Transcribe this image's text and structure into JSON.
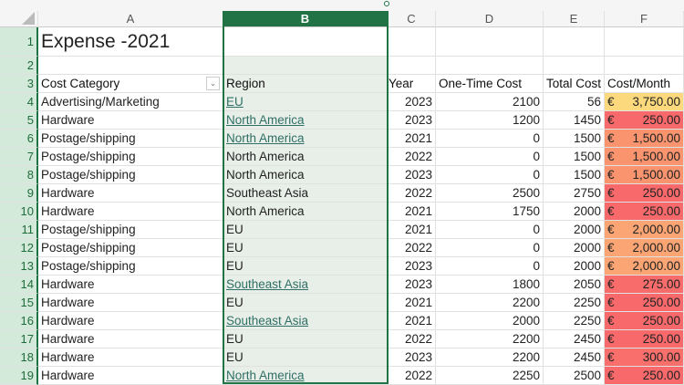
{
  "columns": [
    "A",
    "B",
    "C",
    "D",
    "E",
    "F"
  ],
  "title": "Expense -2021",
  "headers": {
    "a": "Cost Category",
    "b": "Region",
    "c": "Year",
    "d": "One-Time Cost",
    "e": "Total Cost",
    "f": "Cost/Month"
  },
  "currency_symbol": "€",
  "rows": [
    {
      "n": "4",
      "a": "Advertising/Marketing",
      "b": "EU",
      "link": true,
      "c": "2023",
      "d": "2100",
      "e": "56",
      "f": "3,750.00",
      "color": "#fbd97c"
    },
    {
      "n": "5",
      "a": "Hardware",
      "b": "North America",
      "link": true,
      "c": "2023",
      "d": "1200",
      "e": "1450",
      "f": "250.00",
      "color": "#f8696b"
    },
    {
      "n": "6",
      "a": "Postage/shipping",
      "b": "North America",
      "link": true,
      "c": "2021",
      "d": "0",
      "e": "1500",
      "f": "1,500.00",
      "color": "#f9946f"
    },
    {
      "n": "7",
      "a": "Postage/shipping",
      "b": "North America",
      "link": false,
      "c": "2022",
      "d": "0",
      "e": "1500",
      "f": "1,500.00",
      "color": "#f9946f"
    },
    {
      "n": "8",
      "a": "Postage/shipping",
      "b": "North America",
      "link": false,
      "c": "2023",
      "d": "0",
      "e": "1500",
      "f": "1,500.00",
      "color": "#f9946f"
    },
    {
      "n": "9",
      "a": "Hardware",
      "b": "Southeast Asia",
      "link": false,
      "c": "2022",
      "d": "2500",
      "e": "2750",
      "f": "250.00",
      "color": "#f8696b"
    },
    {
      "n": "10",
      "a": "Hardware",
      "b": "North America",
      "link": false,
      "c": "2021",
      "d": "1750",
      "e": "2000",
      "f": "250.00",
      "color": "#f8696b"
    },
    {
      "n": "11",
      "a": "Postage/shipping",
      "b": "EU",
      "link": false,
      "c": "2021",
      "d": "0",
      "e": "2000",
      "f": "2,000.00",
      "color": "#fba574"
    },
    {
      "n": "12",
      "a": "Postage/shipping",
      "b": "EU",
      "link": false,
      "c": "2022",
      "d": "0",
      "e": "2000",
      "f": "2,000.00",
      "color": "#fba574"
    },
    {
      "n": "13",
      "a": "Postage/shipping",
      "b": "EU",
      "link": false,
      "c": "2023",
      "d": "0",
      "e": "2000",
      "f": "2,000.00",
      "color": "#fba574"
    },
    {
      "n": "14",
      "a": "Hardware",
      "b": "Southeast Asia",
      "link": true,
      "c": "2023",
      "d": "1800",
      "e": "2050",
      "f": "275.00",
      "color": "#f86c6b"
    },
    {
      "n": "15",
      "a": "Hardware",
      "b": "EU",
      "link": false,
      "c": "2021",
      "d": "2200",
      "e": "2250",
      "f": "250.00",
      "color": "#f8696b"
    },
    {
      "n": "16",
      "a": "Hardware",
      "b": "Southeast Asia",
      "link": true,
      "c": "2021",
      "d": "2000",
      "e": "2250",
      "f": "250.00",
      "color": "#f8696b"
    },
    {
      "n": "17",
      "a": "Hardware",
      "b": "EU",
      "link": false,
      "c": "2022",
      "d": "2200",
      "e": "2450",
      "f": "250.00",
      "color": "#f8696b"
    },
    {
      "n": "18",
      "a": "Hardware",
      "b": "EU",
      "link": false,
      "c": "2023",
      "d": "2200",
      "e": "2450",
      "f": "300.00",
      "color": "#f86f6c"
    },
    {
      "n": "19",
      "a": "Hardware",
      "b": "North America",
      "link": true,
      "c": "2022",
      "d": "2250",
      "e": "2500",
      "f": "250.00",
      "color": "#f8696b"
    }
  ],
  "row_numbers": [
    "1",
    "2",
    "3"
  ]
}
